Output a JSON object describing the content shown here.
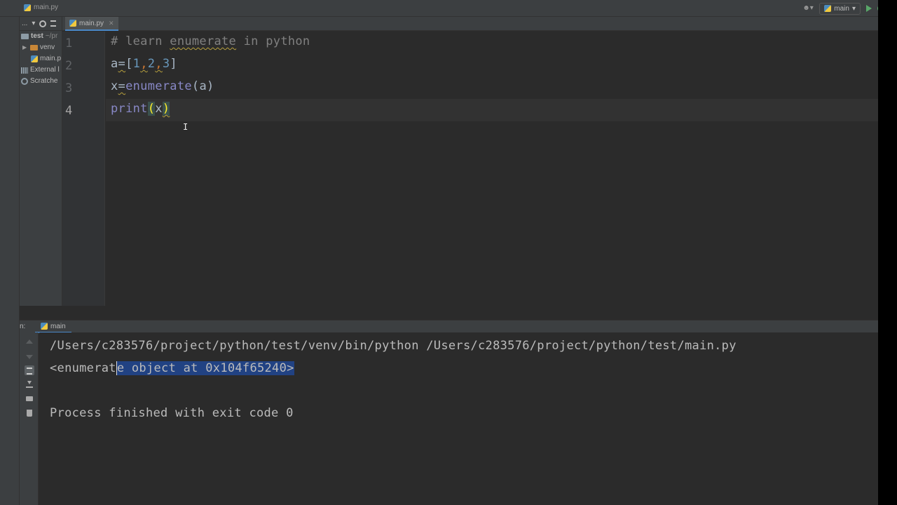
{
  "titlebar": {
    "file": "main.py",
    "run_config": "main",
    "icons": [
      "python-file-icon",
      "user-icon",
      "run-icon",
      "debug-icon",
      "settings-icon"
    ]
  },
  "project": {
    "toolbar_label": "...",
    "tree": [
      {
        "label": "test",
        "suffix": "~/pr",
        "icon": "folder-icon"
      },
      {
        "label": "venv",
        "icon": "folder-icon"
      },
      {
        "label": "main.p",
        "icon": "python-file-icon"
      },
      {
        "label": "External l",
        "icon": "libraries-icon"
      },
      {
        "label": "Scratche",
        "icon": "scratches-icon"
      }
    ]
  },
  "editor": {
    "tab": "main.py",
    "lines": [
      {
        "num": "1",
        "text": "# learn enumerate in python"
      },
      {
        "num": "2",
        "a": "a",
        "eq": "=",
        "open": "[",
        "v1": "1",
        "c1": ",",
        "v2": "2",
        "c2": ",",
        "v3": "3",
        "close": "]"
      },
      {
        "num": "3",
        "x": "x",
        "eq": "=",
        "fn": "enumerate",
        "args": "(a)"
      },
      {
        "num": "4",
        "fn": "print",
        "open": "(",
        "arg": "x",
        "close": ")"
      }
    ],
    "comment_parts": {
      "pre": "# learn ",
      "word": "enumerate",
      "post": " in python"
    }
  },
  "run": {
    "label": "n:",
    "tab": "main",
    "output": {
      "cmd": "/Users/c283576/project/python/test/venv/bin/python /Users/c283576/project/python/test/main.py",
      "result_pre": "<enumerat",
      "result_sel": "e object at 0x104f65240>",
      "finish": "Process finished with exit code 0"
    }
  }
}
